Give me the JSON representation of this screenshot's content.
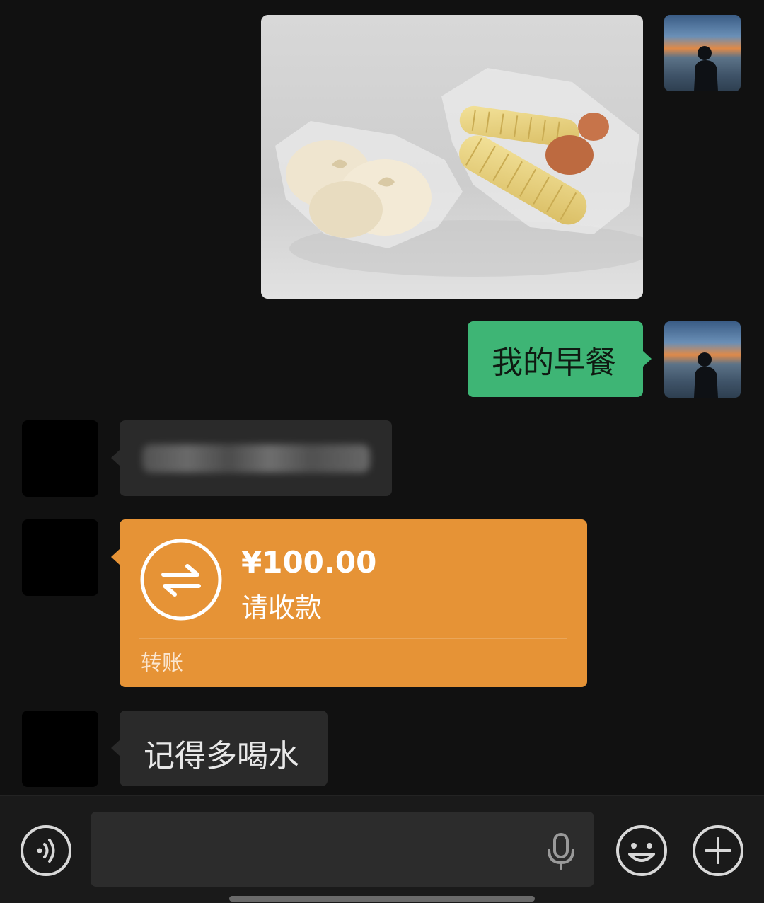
{
  "messages": {
    "sent_text": "我的早餐",
    "received_text_last": "记得多喝水"
  },
  "transfer": {
    "amount": "¥100.00",
    "status": "请收款",
    "label": "转账"
  },
  "colors": {
    "sent_bubble": "#3eb575",
    "received_bubble": "#2a2a2a",
    "transfer_card": "#e69336",
    "background": "#111111"
  },
  "icons": {
    "voice_toggle": "voice-wave-icon",
    "microphone": "microphone-icon",
    "emoji": "emoji-icon",
    "more": "plus-icon"
  },
  "input": {
    "value": ""
  }
}
